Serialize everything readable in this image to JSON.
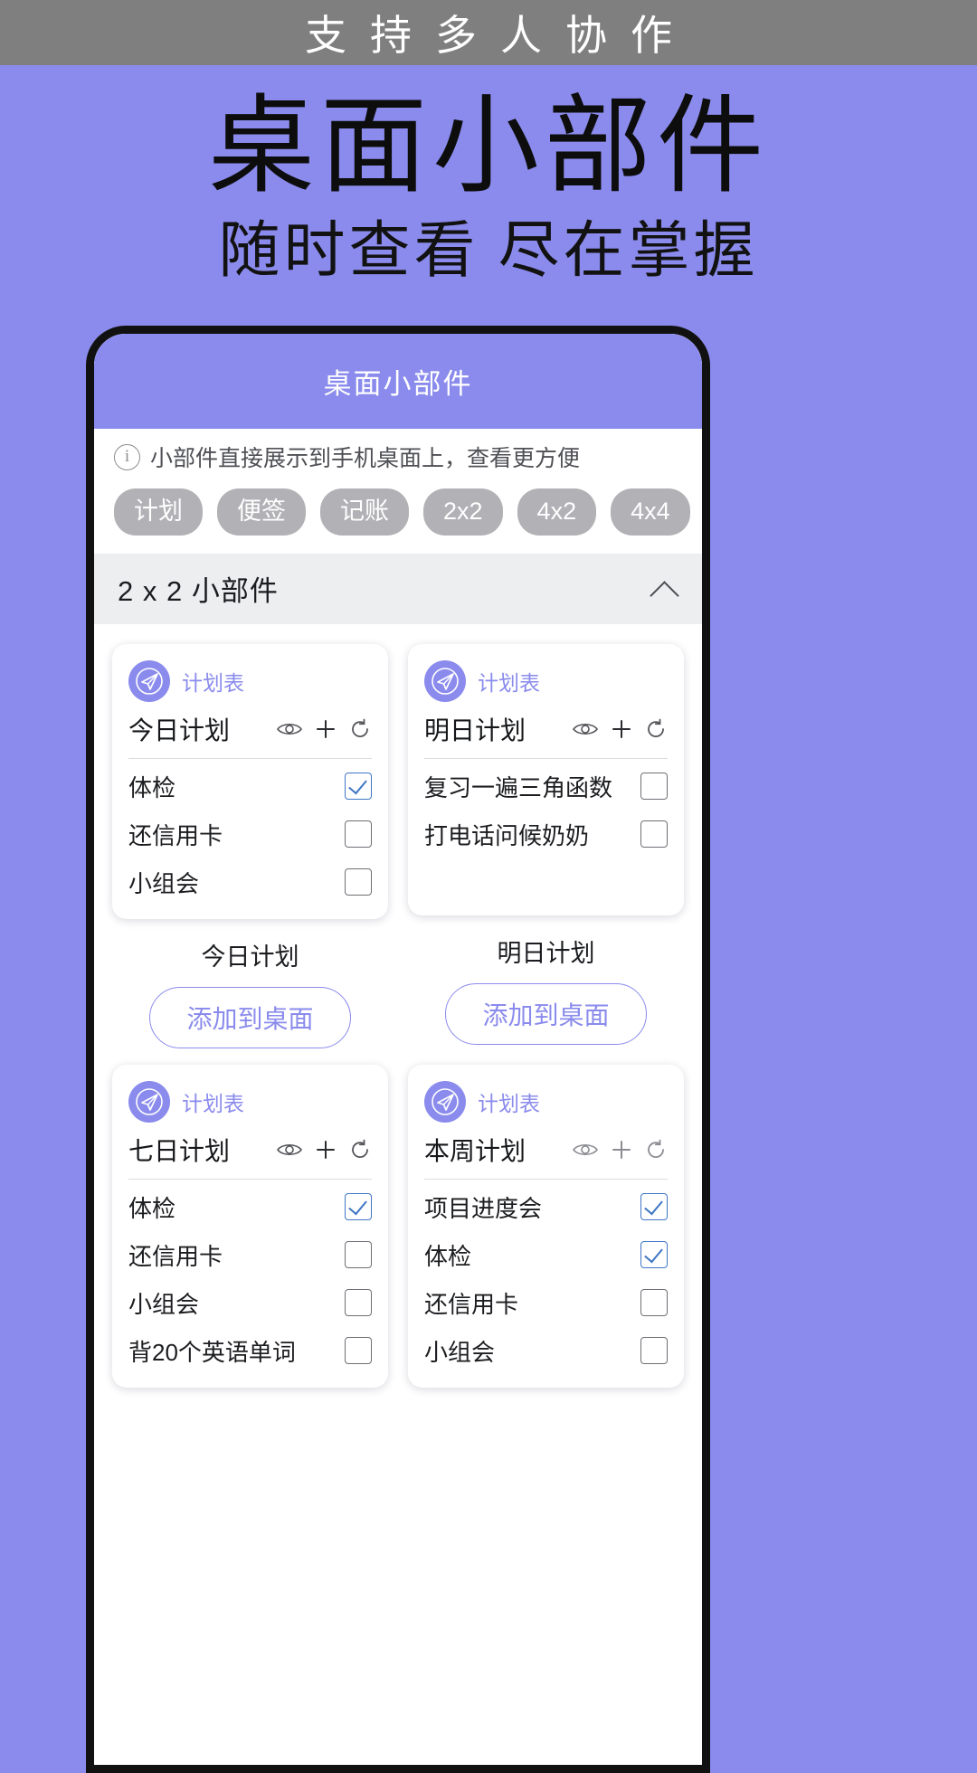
{
  "banner": {
    "text": "支持多人协作"
  },
  "hero": {
    "title": "桌面小部件",
    "subtitle": "随时查看 尽在掌握"
  },
  "phone": {
    "header_title": "桌面小部件",
    "info": {
      "icon": "info-circle-icon",
      "text": "小部件直接展示到手机桌面上，查看更方便"
    },
    "chips": [
      {
        "label": "计划"
      },
      {
        "label": "便签"
      },
      {
        "label": "记账"
      },
      {
        "label": "2x2"
      },
      {
        "label": "4x2"
      },
      {
        "label": "4x4"
      }
    ],
    "section": {
      "title": "2 x 2 小部件",
      "chevron": "chevron-up-icon"
    },
    "widgets": [
      {
        "brand": "计划表",
        "title": "今日计划",
        "icons": [
          "eye-icon",
          "plus-icon",
          "refresh-icon"
        ],
        "items": [
          {
            "label": "体检",
            "checked": true
          },
          {
            "label": "还信用卡",
            "checked": false
          },
          {
            "label": "小组会",
            "checked": false
          }
        ],
        "caption": "今日计划",
        "add_label": "添加到桌面"
      },
      {
        "brand": "计划表",
        "title": "明日计划",
        "icons": [
          "eye-icon",
          "plus-icon",
          "refresh-icon"
        ],
        "items": [
          {
            "label": "复习一遍三角函数",
            "checked": false
          },
          {
            "label": "打电话问候奶奶",
            "checked": false
          }
        ],
        "caption": "明日计划",
        "add_label": "添加到桌面"
      },
      {
        "brand": "计划表",
        "title": "七日计划",
        "icons": [
          "eye-icon",
          "plus-icon",
          "refresh-icon"
        ],
        "items": [
          {
            "label": "体检",
            "checked": true
          },
          {
            "label": "还信用卡",
            "checked": false
          },
          {
            "label": "小组会",
            "checked": false
          },
          {
            "label": "背20个英语单词",
            "checked": false
          }
        ]
      },
      {
        "brand": "计划表",
        "title": "本周计划",
        "icons": [
          "eye-icon",
          "plus-icon",
          "refresh-icon"
        ],
        "items": [
          {
            "label": "项目进度会",
            "checked": true
          },
          {
            "label": "体检",
            "checked": true
          },
          {
            "label": "还信用卡",
            "checked": false
          },
          {
            "label": "小组会",
            "checked": false
          }
        ]
      }
    ]
  },
  "colors": {
    "accent": "#8a8bec",
    "banner_bg": "#7f7f7f",
    "chip_bg": "#b2b2b6",
    "check": "#3f76c4"
  }
}
